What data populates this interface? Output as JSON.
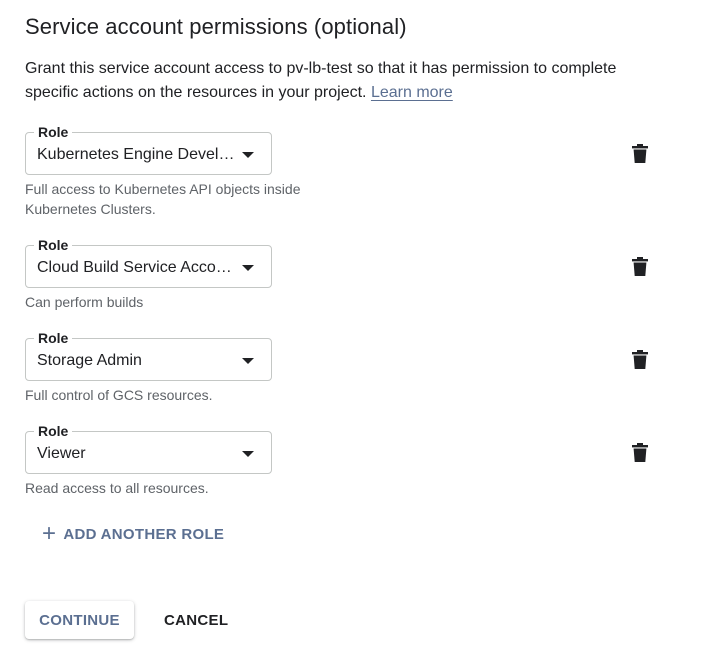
{
  "section": {
    "title": "Service account permissions (optional)",
    "description": "Grant this service account access to pv-lb-test so that it has permission to complete specific actions on the resources in your project.",
    "learn_more": "Learn more"
  },
  "roles": [
    {
      "label": "Role",
      "value": "Kubernetes Engine Developer",
      "hint": "Full access to Kubernetes API objects inside Kubernetes Clusters."
    },
    {
      "label": "Role",
      "value": "Cloud Build Service Account",
      "hint": "Can perform builds"
    },
    {
      "label": "Role",
      "value": "Storage Admin",
      "hint": "Full control of GCS resources."
    },
    {
      "label": "Role",
      "value": "Viewer",
      "hint": "Read access to all resources."
    }
  ],
  "add_role": {
    "icon": "+",
    "label": "ADD ANOTHER ROLE"
  },
  "actions": {
    "continue_label": "CONTINUE",
    "cancel_label": "CANCEL"
  },
  "colors": {
    "accent": "#5b6f91",
    "text": "#202124",
    "hint": "#5f6368",
    "border": "#c4c7c5"
  }
}
